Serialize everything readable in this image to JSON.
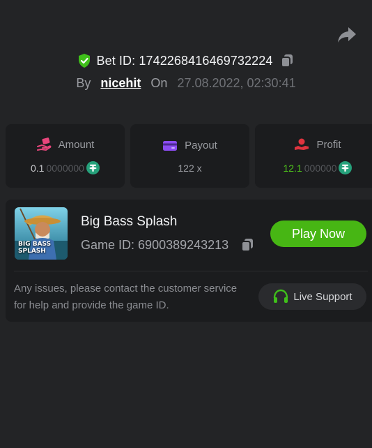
{
  "header": {
    "bet_label": "Bet ID:",
    "bet_id": "1742268416469732224",
    "by_label": "By",
    "username": "nicehit",
    "on_label": "On",
    "datetime": "27.08.2022, 02:30:41"
  },
  "stats": {
    "amount": {
      "label": "Amount",
      "value_main": "0.1",
      "value_rest": "0000000",
      "currency_icon": "tether-icon"
    },
    "payout": {
      "label": "Payout",
      "value": "122 x"
    },
    "profit": {
      "label": "Profit",
      "value_main": "12.1",
      "value_rest": "000000",
      "currency_icon": "tether-icon"
    }
  },
  "game": {
    "name": "Big Bass Splash",
    "id_label": "Game ID:",
    "id": "6900389243213",
    "thumb_text_1": "BIG BASS",
    "thumb_text_2": "SPLASH",
    "play_label": "Play Now"
  },
  "support": {
    "text": "Any issues, please contact the customer service for help and provide the game ID.",
    "button_label": "Live Support"
  },
  "colors": {
    "background": "#232426",
    "card": "#1b1c1e",
    "accent_green": "#47b614",
    "profit_green": "#4fc51c",
    "tether": "#26a17b"
  }
}
